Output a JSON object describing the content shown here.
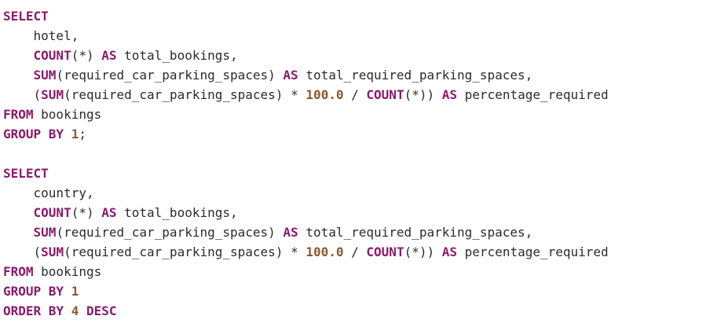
{
  "colors": {
    "keyword": "#8b1a6b",
    "number": "#8c5a2b",
    "text": "#2b2b2b",
    "background": "#ffffff"
  },
  "lines": [
    [
      {
        "t": "kw",
        "v": "SELECT"
      }
    ],
    [
      {
        "t": "plain",
        "v": "    hotel,"
      }
    ],
    [
      {
        "t": "plain",
        "v": "    "
      },
      {
        "t": "kw",
        "v": "COUNT"
      },
      {
        "t": "plain",
        "v": "(*) "
      },
      {
        "t": "kw",
        "v": "AS"
      },
      {
        "t": "plain",
        "v": " total_bookings,"
      }
    ],
    [
      {
        "t": "plain",
        "v": "    "
      },
      {
        "t": "kw",
        "v": "SUM"
      },
      {
        "t": "plain",
        "v": "(required_car_parking_spaces) "
      },
      {
        "t": "kw",
        "v": "AS"
      },
      {
        "t": "plain",
        "v": " total_required_parking_spaces,"
      }
    ],
    [
      {
        "t": "plain",
        "v": "    ("
      },
      {
        "t": "kw",
        "v": "SUM"
      },
      {
        "t": "plain",
        "v": "(required_car_parking_spaces) * "
      },
      {
        "t": "num",
        "v": "100.0"
      },
      {
        "t": "plain",
        "v": " / "
      },
      {
        "t": "kw",
        "v": "COUNT"
      },
      {
        "t": "plain",
        "v": "(*)) "
      },
      {
        "t": "kw",
        "v": "AS"
      },
      {
        "t": "plain",
        "v": " percentage_required"
      }
    ],
    [
      {
        "t": "kw",
        "v": "FROM"
      },
      {
        "t": "plain",
        "v": " bookings"
      }
    ],
    [
      {
        "t": "kw",
        "v": "GROUP BY"
      },
      {
        "t": "plain",
        "v": " "
      },
      {
        "t": "num",
        "v": "1"
      },
      {
        "t": "plain",
        "v": ";"
      }
    ],
    [],
    [
      {
        "t": "kw",
        "v": "SELECT"
      }
    ],
    [
      {
        "t": "plain",
        "v": "    country,"
      }
    ],
    [
      {
        "t": "plain",
        "v": "    "
      },
      {
        "t": "kw",
        "v": "COUNT"
      },
      {
        "t": "plain",
        "v": "(*) "
      },
      {
        "t": "kw",
        "v": "AS"
      },
      {
        "t": "plain",
        "v": " total_bookings,"
      }
    ],
    [
      {
        "t": "plain",
        "v": "    "
      },
      {
        "t": "kw",
        "v": "SUM"
      },
      {
        "t": "plain",
        "v": "(required_car_parking_spaces) "
      },
      {
        "t": "kw",
        "v": "AS"
      },
      {
        "t": "plain",
        "v": " total_required_parking_spaces,"
      }
    ],
    [
      {
        "t": "plain",
        "v": "    ("
      },
      {
        "t": "kw",
        "v": "SUM"
      },
      {
        "t": "plain",
        "v": "(required_car_parking_spaces) * "
      },
      {
        "t": "num",
        "v": "100.0"
      },
      {
        "t": "plain",
        "v": " / "
      },
      {
        "t": "kw",
        "v": "COUNT"
      },
      {
        "t": "plain",
        "v": "(*)) "
      },
      {
        "t": "kw",
        "v": "AS"
      },
      {
        "t": "plain",
        "v": " percentage_required"
      }
    ],
    [
      {
        "t": "kw",
        "v": "FROM"
      },
      {
        "t": "plain",
        "v": " bookings"
      }
    ],
    [
      {
        "t": "kw",
        "v": "GROUP BY"
      },
      {
        "t": "plain",
        "v": " "
      },
      {
        "t": "num",
        "v": "1"
      }
    ],
    [
      {
        "t": "kw",
        "v": "ORDER BY"
      },
      {
        "t": "plain",
        "v": " "
      },
      {
        "t": "num",
        "v": "4"
      },
      {
        "t": "plain",
        "v": " "
      },
      {
        "t": "kw",
        "v": "DESC"
      }
    ]
  ]
}
